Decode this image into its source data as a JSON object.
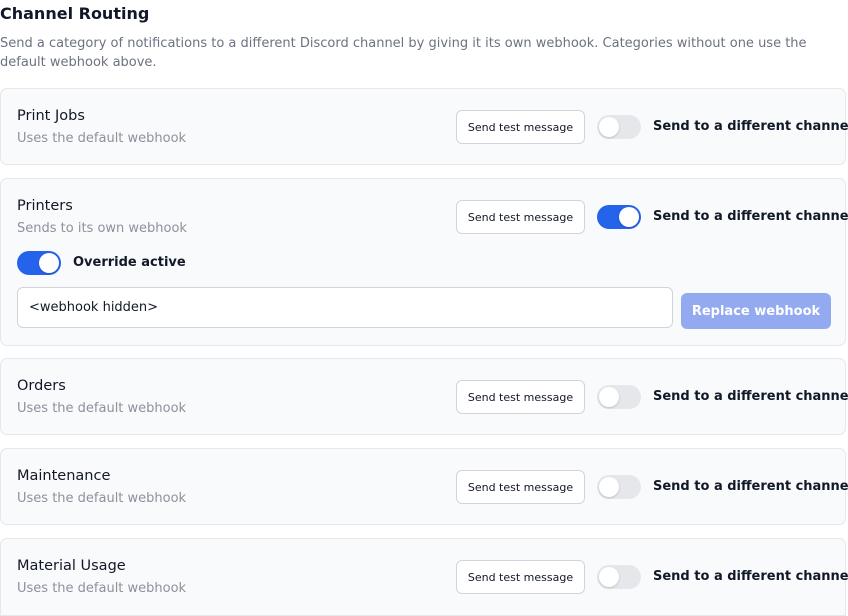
{
  "section": {
    "title": "Channel Routing",
    "description": "Send a category of notifications to a different Discord channel by giving it its own webhook. Categories without one use the default webhook above."
  },
  "labels": {
    "test_button": "Send test message",
    "route_toggle": "Send to a different channel",
    "override_toggle": "Override active",
    "replace_button": "Replace webhook"
  },
  "colors": {
    "toggle_on": "#2563eb",
    "toggle_off": "#e5e7eb",
    "replace_button_disabled": "#93aaf0"
  },
  "categories": [
    {
      "name": "Print Jobs",
      "status": "Uses the default webhook",
      "route_enabled": false
    },
    {
      "name": "Printers",
      "status": "Sends to its own webhook",
      "route_enabled": true,
      "override_active": true,
      "webhook_value": "<webhook hidden>"
    },
    {
      "name": "Orders",
      "status": "Uses the default webhook",
      "route_enabled": false
    },
    {
      "name": "Maintenance",
      "status": "Uses the default webhook",
      "route_enabled": false
    },
    {
      "name": "Material Usage",
      "status": "Uses the default webhook",
      "route_enabled": false
    }
  ]
}
